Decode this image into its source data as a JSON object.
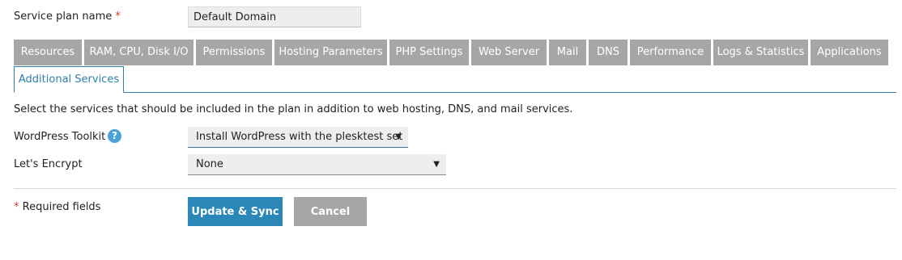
{
  "plan_name": {
    "label": "Service plan name",
    "required_mark": "*",
    "value": "Default Domain"
  },
  "tabs": [
    {
      "label": "Resources"
    },
    {
      "label": "RAM, CPU, Disk I/O"
    },
    {
      "label": "Permissions"
    },
    {
      "label": "Hosting Parameters"
    },
    {
      "label": "PHP Settings"
    },
    {
      "label": "Web Server"
    },
    {
      "label": "Mail"
    },
    {
      "label": "DNS"
    },
    {
      "label": "Performance"
    },
    {
      "label": "Logs & Statistics"
    },
    {
      "label": "Applications"
    }
  ],
  "active_tab": {
    "label": "Additional Services"
  },
  "intro_text": "Select the services that should be included in the plan in addition to web hosting, DNS, and mail services.",
  "fields": {
    "wordpress_toolkit": {
      "label": "WordPress Toolkit",
      "help_icon": "?",
      "selected": "Install WordPress with the plesktest set"
    },
    "lets_encrypt": {
      "label": "Let's Encrypt",
      "selected": "None"
    }
  },
  "footer": {
    "required_mark": "*",
    "required_text": "Required fields",
    "update_label": "Update & Sync",
    "cancel_label": "Cancel"
  },
  "colors": {
    "accent": "#2a87b8",
    "tab_inactive": "#a6a6a6",
    "required": "#d43b1f",
    "help_icon": "#4aa3d6"
  },
  "icons": {
    "help": "help-icon",
    "dropdown": "chevron-down-icon"
  }
}
